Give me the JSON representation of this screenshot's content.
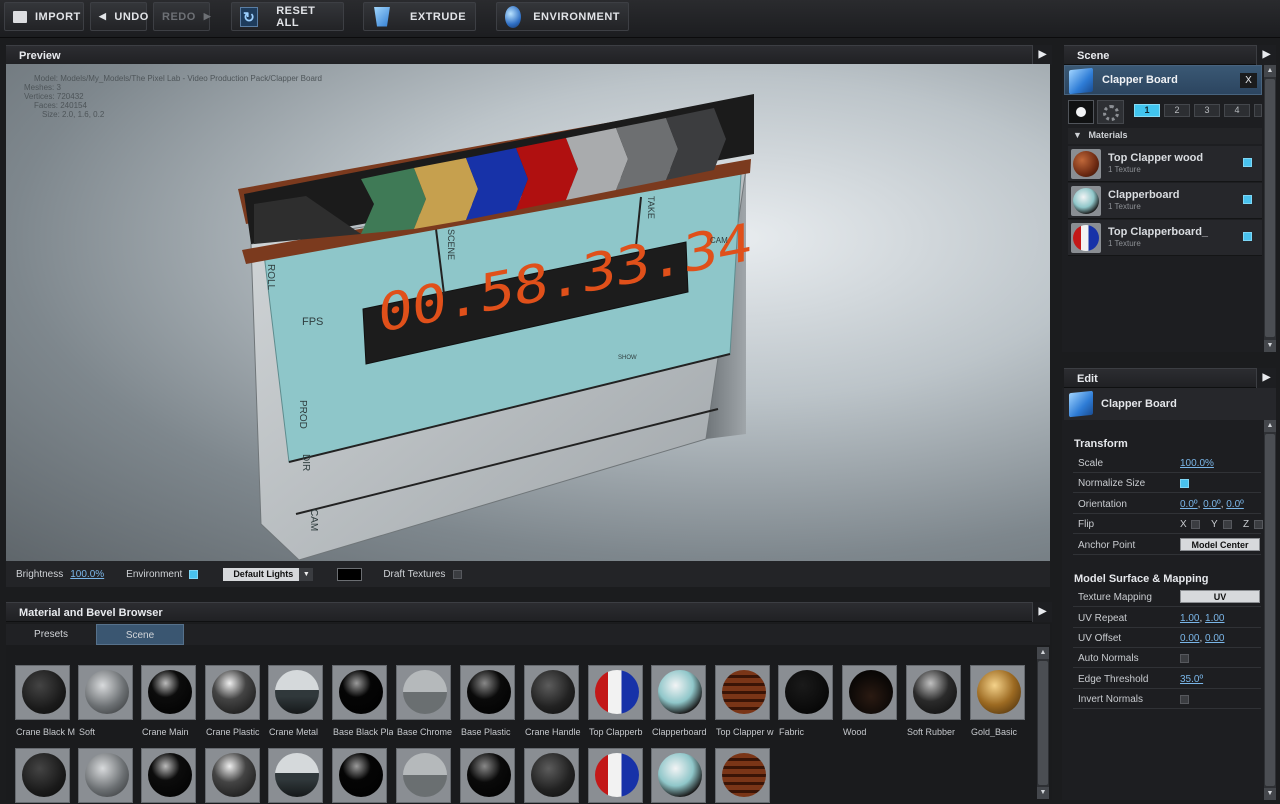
{
  "toolbar": {
    "import": "IMPORT",
    "undo": "UNDO",
    "redo": "REDO",
    "reset_all": "RESET ALL",
    "extrude": "EXTRUDE",
    "environment": "ENVIRONMENT"
  },
  "preview": {
    "title": "Preview",
    "info": {
      "model": "Model: Models/My_Models/The Pixel Lab - Video Production Pack/Clapper Board",
      "meshes": "Meshes: 3",
      "vertices": "Vertices: 720432",
      "faces": "Faces: 240154",
      "size": "Size: 2.0, 1.6, 0.2"
    },
    "timecode": "00.58.33.34",
    "slate_labels": {
      "roll": "ROLL",
      "scene": "SCENE",
      "take": "TAKE",
      "cam_top": "CAM",
      "fps": "FPS",
      "prod": "PROD",
      "dir": "DIR",
      "cam_bottom": "CAM",
      "show": "SHOW"
    }
  },
  "preview_bar": {
    "brightness_label": "Brightness",
    "brightness_value": "100.0%",
    "environment_label": "Environment",
    "lights_value": "Default Lights",
    "draft_textures_label": "Draft Textures"
  },
  "material_browser": {
    "title": "Material and Bevel Browser",
    "tabs": [
      "Presets",
      "Scene"
    ],
    "active_tab": "Scene",
    "row1": [
      "Crane Black M",
      "Soft",
      "Crane Main",
      "Crane Plastic",
      "Crane Metal",
      "Base Black Pla",
      "Base Chrome",
      "Base Plastic",
      "Crane Handle",
      "Top Clapperb",
      "Clapperboard",
      "Top Clapper w",
      "Fabric",
      "Wood",
      "Soft Rubber",
      "Gold_Basic"
    ]
  },
  "scene": {
    "title": "Scene",
    "object_name": "Clapper Board",
    "close_label": "X",
    "layers": [
      "1",
      "2",
      "3",
      "4"
    ],
    "materials_header": "Materials",
    "materials": [
      {
        "name": "Top Clapper wood",
        "sub": "1 Texture"
      },
      {
        "name": "Clapperboard",
        "sub": "1 Texture"
      },
      {
        "name": "Top Clapperboard_",
        "sub": "1 Texture"
      }
    ]
  },
  "edit": {
    "title": "Edit",
    "object_name": "Clapper Board",
    "transform_header": "Transform",
    "scale_label": "Scale",
    "scale_value": "100.0%",
    "normalize_label": "Normalize Size",
    "orientation_label": "Orientation",
    "orientation_x": "0.0º",
    "orientation_y": "0.0º",
    "orientation_z": "0.0º",
    "flip_label": "Flip",
    "flip_x": "X",
    "flip_y": "Y",
    "flip_z": "Z",
    "anchor_label": "Anchor Point",
    "anchor_value": "Model Center",
    "surface_header": "Model Surface & Mapping",
    "texture_mapping_label": "Texture Mapping",
    "texture_mapping_value": "UV",
    "uv_repeat_label": "UV Repeat",
    "uv_repeat_u": "1.00",
    "uv_repeat_v": "1.00",
    "uv_offset_label": "UV Offset",
    "uv_offset_u": "0.00",
    "uv_offset_v": "0.00",
    "auto_normals_label": "Auto Normals",
    "edge_threshold_label": "Edge Threshold",
    "edge_threshold_value": "35.0º",
    "invert_normals_label": "Invert Normals"
  },
  "colors": {
    "accent": "#41c5ef",
    "selection": "#3a5874",
    "timecode": "#e0501a"
  }
}
